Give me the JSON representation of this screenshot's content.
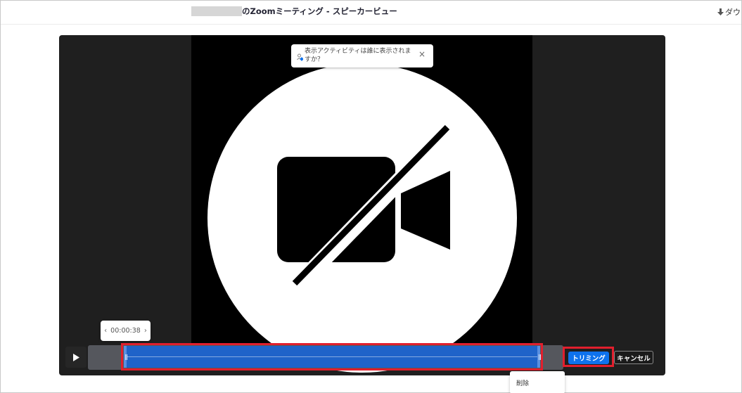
{
  "header": {
    "title": "のZoomミーティング - スピーカービュー",
    "download_label": "ダウ"
  },
  "player": {
    "tooltip_text": "表示アクティビティは誰に表示されますか？",
    "tooltip_close": "×",
    "time_display": "00:00:38",
    "time_prev": "‹",
    "time_next": "›",
    "trim_button": "トリミング",
    "cancel_button": "キャンセル",
    "icons": {
      "play": "play-icon",
      "camera_off": "video-camera-off-icon",
      "download": "download-arrow-icon"
    }
  },
  "context_menu": {
    "delete_label": "削除"
  },
  "colors": {
    "accent": "#0e72ed",
    "selection": "#1f63c9",
    "highlight": "#e11f2d",
    "player_bg": "#1f1f1f"
  }
}
